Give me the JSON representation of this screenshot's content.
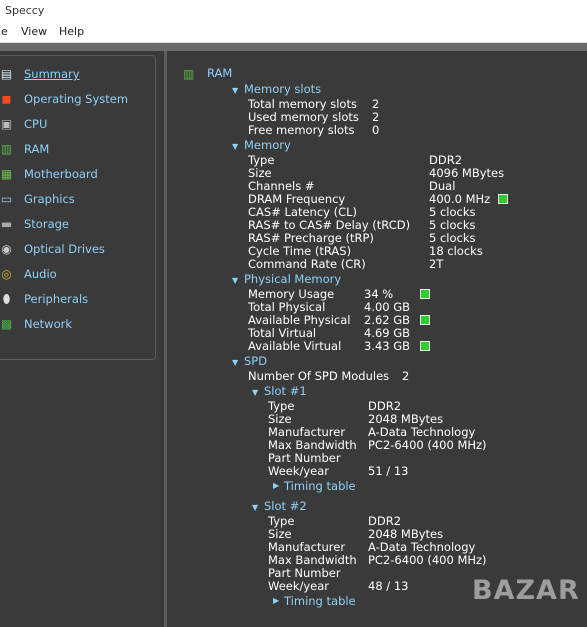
{
  "window": {
    "title": "Speccy"
  },
  "menu": {
    "file": "le",
    "view": "View",
    "help": "Help"
  },
  "sidebar": {
    "items": [
      {
        "label": "Summary",
        "icon": "summary-icon",
        "glyph": "▤",
        "color": "#d6e7f4"
      },
      {
        "label": "Operating System",
        "icon": "windows-logo-icon",
        "glyph": "◼",
        "color": "#f04a1e"
      },
      {
        "label": "CPU",
        "icon": "cpu-chip-icon",
        "glyph": "▣",
        "color": "#bbbbbb"
      },
      {
        "label": "RAM",
        "icon": "ram-module-icon",
        "glyph": "▥",
        "color": "#58b848"
      },
      {
        "label": "Motherboard",
        "icon": "motherboard-icon",
        "glyph": "▦",
        "color": "#6cc04a"
      },
      {
        "label": "Graphics",
        "icon": "monitor-icon",
        "glyph": "▭",
        "color": "#9ec9e8"
      },
      {
        "label": "Storage",
        "icon": "hard-drive-icon",
        "glyph": "▬",
        "color": "#aaaaaa"
      },
      {
        "label": "Optical Drives",
        "icon": "optical-disc-icon",
        "glyph": "◉",
        "color": "#cccccc"
      },
      {
        "label": "Audio",
        "icon": "speaker-icon",
        "glyph": "◎",
        "color": "#e0b030"
      },
      {
        "label": "Peripherals",
        "icon": "mouse-icon",
        "glyph": "⬮",
        "color": "#dddddd"
      },
      {
        "label": "Network",
        "icon": "network-icon",
        "glyph": "▩",
        "color": "#48b048"
      }
    ]
  },
  "ram": {
    "heading": "RAM",
    "memory_slots": {
      "heading": "Memory slots",
      "rows": [
        {
          "label": "Total memory slots",
          "value": "2"
        },
        {
          "label": "Used memory slots",
          "value": "2"
        },
        {
          "label": "Free memory slots",
          "value": "0"
        }
      ]
    },
    "memory": {
      "heading": "Memory",
      "rows": [
        {
          "label": "Type",
          "value": "DDR2"
        },
        {
          "label": "Size",
          "value": "4096 MBytes"
        },
        {
          "label": "Channels #",
          "value": "Dual"
        },
        {
          "label": "DRAM Frequency",
          "value": "400.0 MHz"
        },
        {
          "label": "CAS# Latency (CL)",
          "value": "5 clocks"
        },
        {
          "label": "RAS# to CAS# Delay (tRCD)",
          "value": "5 clocks"
        },
        {
          "label": "RAS# Precharge (tRP)",
          "value": "5 clocks"
        },
        {
          "label": "Cycle Time (tRAS)",
          "value": "18 clocks"
        },
        {
          "label": "Command Rate (CR)",
          "value": "2T"
        }
      ]
    },
    "physical_memory": {
      "heading": "Physical Memory",
      "rows": [
        {
          "label": "Memory Usage",
          "value": "34 %"
        },
        {
          "label": "Total Physical",
          "value": "4.00 GB"
        },
        {
          "label": "Available Physical",
          "value": "2.62 GB"
        },
        {
          "label": "Total Virtual",
          "value": "4.69 GB"
        },
        {
          "label": "Available Virtual",
          "value": "3.43 GB"
        }
      ]
    },
    "spd": {
      "heading": "SPD",
      "modules_label": "Number Of SPD Modules",
      "modules_value": "2",
      "slots": [
        {
          "heading": "Slot #1",
          "rows": [
            {
              "label": "Type",
              "value": "DDR2"
            },
            {
              "label": "Size",
              "value": "2048 MBytes"
            },
            {
              "label": "Manufacturer",
              "value": "A-Data Technology"
            },
            {
              "label": "Max Bandwidth",
              "value": "PC2-6400 (400 MHz)"
            },
            {
              "label": "Part Number",
              "value": ""
            },
            {
              "label": "Week/year",
              "value": "51 / 13"
            }
          ],
          "timing_link": "Timing table"
        },
        {
          "heading": "Slot #2",
          "rows": [
            {
              "label": "Type",
              "value": "DDR2"
            },
            {
              "label": "Size",
              "value": "2048 MBytes"
            },
            {
              "label": "Manufacturer",
              "value": "A-Data Technology"
            },
            {
              "label": "Max Bandwidth",
              "value": "PC2-6400 (400 MHz)"
            },
            {
              "label": "Part Number",
              "value": ""
            },
            {
              "label": "Week/year",
              "value": "48 / 13"
            }
          ],
          "timing_link": "Timing table"
        }
      ]
    }
  },
  "watermark": "BAZAR",
  "colors": {
    "accent": "#8fd1f7",
    "indicator": "#2ecc2e",
    "background": "#3a3a3a"
  }
}
